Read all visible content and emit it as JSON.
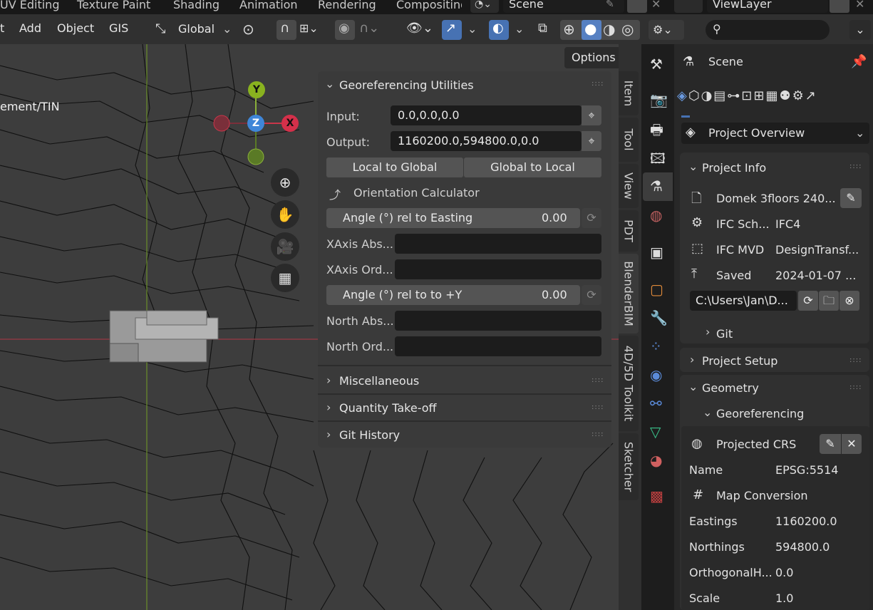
{
  "topbar": {
    "tabs": [
      "UV Editing",
      "Texture Paint",
      "Shading",
      "Animation",
      "Rendering",
      "Compositing"
    ],
    "scene": "Scene",
    "view_layer": "ViewLayer"
  },
  "header": {
    "menus": [
      "t",
      "Add",
      "Object",
      "GIS"
    ],
    "transform_orientation": "Global",
    "options_label": "Options"
  },
  "viewport": {
    "overlay_text": "ement/TIN",
    "gizmo": {
      "x": "X",
      "y": "Y",
      "z": "Z"
    }
  },
  "geo_panel": {
    "title": "Georeferencing Utilities",
    "input_label": "Input:",
    "input_value": "0.0,0.0,0.0",
    "output_label": "Output:",
    "output_value": "1160200.0,594800.0,0.0",
    "local_to_global": "Local to Global",
    "global_to_local": "Global to Local",
    "orientation_calculator": "Orientation Calculator",
    "angle_easting_label": "Angle (°) rel to Easting",
    "angle_easting_value": "0.00",
    "xaxis_abs_label": "XAxis Abs...",
    "xaxis_ord_label": "XAxis Ord...",
    "angle_y_label": "Angle (°) rel to to +Y",
    "angle_y_value": "0.00",
    "north_abs_label": "North Abs...",
    "north_ord_label": "North Ord...",
    "sections": [
      "Miscellaneous",
      "Quantity Take-off",
      "Git History"
    ]
  },
  "vertical_tabs": [
    "Item",
    "Tool",
    "View",
    "PDT",
    "BlenderBIM",
    "4D/5D Toolkit",
    "Sketcher"
  ],
  "properties": {
    "header_title": "Scene",
    "project_overview": "Project Overview",
    "project_info": {
      "title": "Project Info",
      "file_name": "Domek 3floors 240...",
      "ifc_schema_label": "IFC Sch...",
      "ifc_schema_value": "IFC4",
      "ifc_mvd_label": "IFC MVD",
      "ifc_mvd_value": "DesignTransf...",
      "saved_label": "Saved",
      "saved_value": "2024-01-07 ...",
      "path_value": "C:\\Users\\Jan\\D...",
      "git_label": "Git"
    },
    "project_setup": "Project Setup",
    "geometry": "Geometry",
    "georeferencing": "Georeferencing",
    "projected_crs": "Projected CRS",
    "name_label": "Name",
    "name_value": "EPSG:5514",
    "map_conversion": "Map Conversion",
    "eastings_label": "Eastings",
    "eastings_value": "1160200.0",
    "northings_label": "Northings",
    "northings_value": "594800.0",
    "orthogonal_label": "OrthogonalH...",
    "orthogonal_value": "0.0",
    "scale_label": "Scale",
    "scale_value": "1.0"
  }
}
